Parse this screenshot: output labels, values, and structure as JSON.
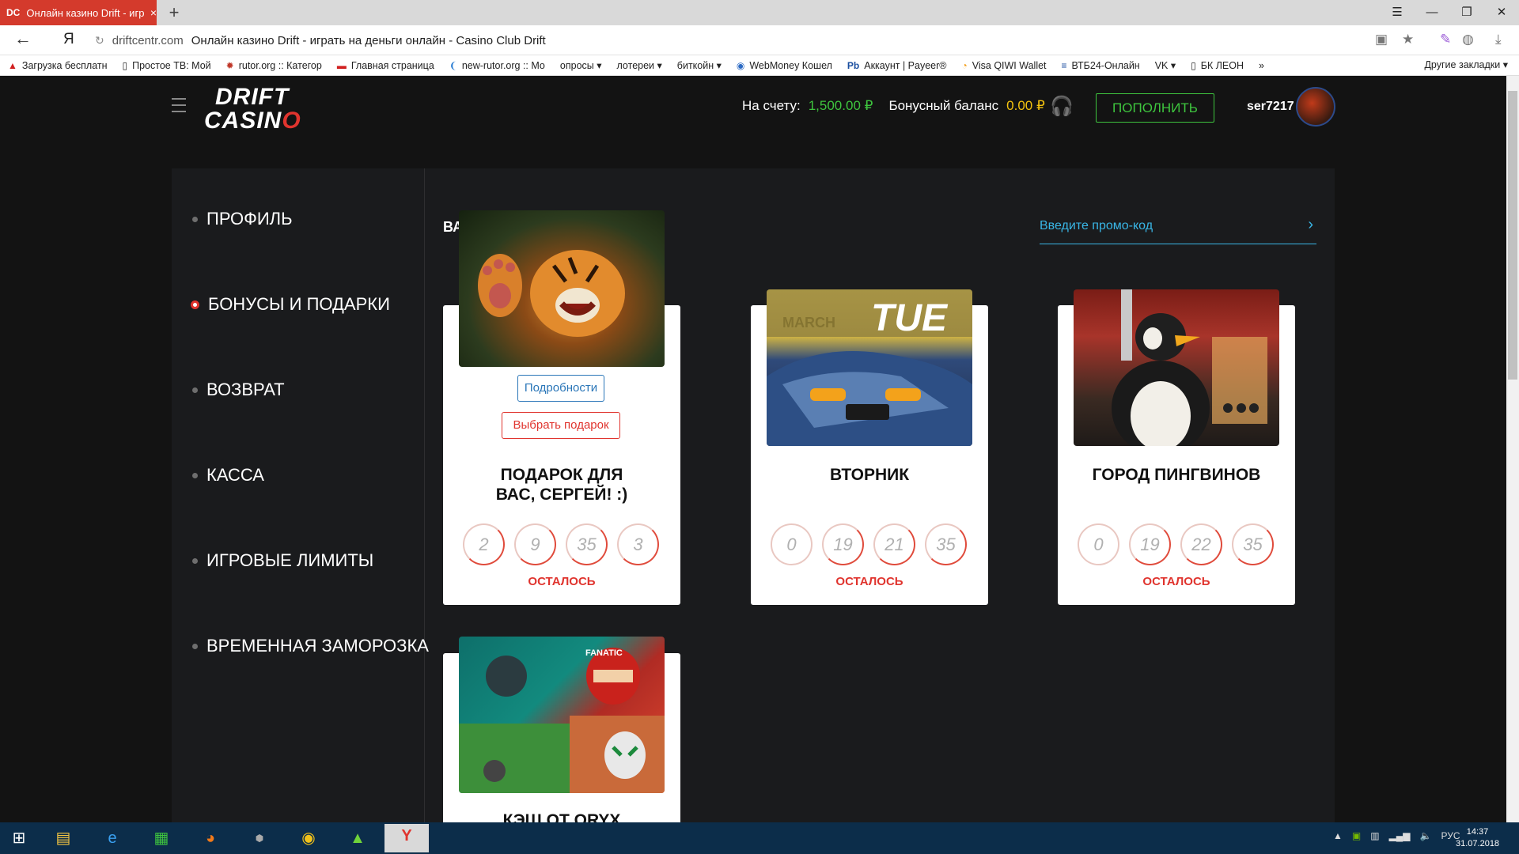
{
  "browser": {
    "tab_icon": "DC",
    "tab_title": "Онлайн казино Drift - игр",
    "tab_close": "×",
    "new_tab": "+",
    "nav_back": "←",
    "yandex_logo": "Я",
    "url_host": "driftcentr.com",
    "page_title": "Онлайн казино Drift - играть на деньги онлайн - Casino Club Drift",
    "bookmarks": [
      {
        "label": "Загрузка бесплатн",
        "icon": "adobe-icon"
      },
      {
        "label": "Простое ТВ: Мой",
        "icon": "page-icon"
      },
      {
        "label": "rutor.org :: Категор",
        "icon": "rutor-icon"
      },
      {
        "label": "Главная страница",
        "icon": "bank-icon"
      },
      {
        "label": "new-rutor.org :: Мо",
        "icon": "rutor-icon"
      },
      {
        "label": "опросы ▾",
        "icon": ""
      },
      {
        "label": "лотереи ▾",
        "icon": ""
      },
      {
        "label": "биткойн ▾",
        "icon": ""
      },
      {
        "label": "WebMoney Кошел",
        "icon": "webmoney-icon"
      },
      {
        "label": "Аккаунт | Payeer®",
        "icon": "payeer-icon"
      },
      {
        "label": "Visa QIWI Wallet",
        "icon": "qiwi-icon"
      },
      {
        "label": "ВТБ24-Онлайн",
        "icon": "vtb-icon"
      },
      {
        "label": "VK ▾",
        "icon": ""
      },
      {
        "label": "БК ЛЕОН",
        "icon": "page-icon"
      },
      {
        "label": "»",
        "icon": ""
      }
    ],
    "other_bookmarks": "Другие закладки ▾"
  },
  "header": {
    "logo_line1": "DRIFT",
    "logo_line2_a": "CASIN",
    "logo_line2_b": "O",
    "balance_label": "На счету:",
    "balance_value": "1,500.00 ₽",
    "bonus_label": "Бонусный баланс",
    "bonus_value": "0.00 ₽",
    "deposit_button": "ПОПОЛНИТЬ",
    "username": "ser7217"
  },
  "sidebar": {
    "items": [
      {
        "label": "ПРОФИЛЬ",
        "active": false
      },
      {
        "label": "БОНУСЫ И ПОДАРКИ",
        "active": true
      },
      {
        "label": "ВОЗВРАТ",
        "active": false
      },
      {
        "label": "КАССА",
        "active": false
      },
      {
        "label": "ИГРОВЫЕ ЛИМИТЫ",
        "active": false
      },
      {
        "label": "ВРЕМЕННАЯ ЗАМОРОЗКА",
        "active": false
      }
    ]
  },
  "main": {
    "section_title": "ВА",
    "promo_placeholder": "Введите промо-код",
    "cards": [
      {
        "title": "ПОДАРОК ДЛЯ ВАС, СЕРГЕЙ! :)",
        "timer": [
          "2",
          "9",
          "35",
          "3"
        ],
        "remaining": "ОСТАЛОСЬ",
        "details_button": "Подробности",
        "choose_button": "Выбрать подарок"
      },
      {
        "title": "ВТОРНИК",
        "timer": [
          "0",
          "19",
          "21",
          "35"
        ],
        "remaining": "ОСТАЛОСЬ",
        "image_text": "TUE",
        "image_month": "MARCH"
      },
      {
        "title": "ГОРОД ПИНГВИНОВ",
        "timer": [
          "0",
          "19",
          "22",
          "35"
        ],
        "remaining": "ОСТАЛОСЬ"
      },
      {
        "title": "КЭШ ОТ ORYX",
        "image_badge": "FANATIC"
      }
    ]
  },
  "taskbar": {
    "language": "РУС",
    "time": "14:37",
    "date": "31.07.2018"
  }
}
